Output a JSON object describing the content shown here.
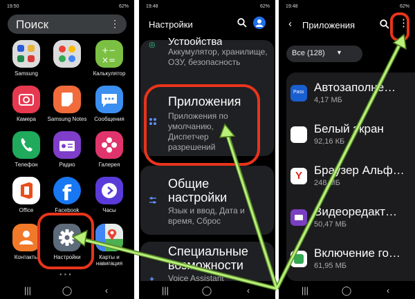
{
  "phone1": {
    "status": {
      "time": "19:50",
      "battery": "62%"
    },
    "search": {
      "label": "Поиск"
    },
    "apps": [
      {
        "label": "Samsung",
        "icon": "samsung-folder-icon"
      },
      {
        "label": "",
        "icon": "google-folder-icon"
      },
      {
        "label": "Калькулятор",
        "icon": "calculator-icon"
      },
      {
        "label": "Камера",
        "icon": "camera-icon"
      },
      {
        "label": "Samsung Notes",
        "icon": "notes-icon"
      },
      {
        "label": "Сообщения",
        "icon": "messages-icon"
      },
      {
        "label": "Телефон",
        "icon": "phone-icon"
      },
      {
        "label": "Радио",
        "icon": "radio-icon"
      },
      {
        "label": "Галерея",
        "icon": "gallery-icon"
      },
      {
        "label": "Office",
        "icon": "office-icon"
      },
      {
        "label": "Facebook",
        "icon": "facebook-icon"
      },
      {
        "label": "Часы",
        "icon": "clock-icon"
      },
      {
        "label": "Контакты",
        "icon": "contacts-icon"
      },
      {
        "label": "Настройки",
        "icon": "settings-gear-icon"
      },
      {
        "label": "Карты и навигация",
        "icon": "maps-icon"
      }
    ]
  },
  "phone2": {
    "status": {
      "time": "19:48",
      "battery": "62%"
    },
    "header": {
      "title": "Настройки"
    },
    "rows": [
      {
        "title": "Устройства",
        "sub": "Аккумулятор, хранилище, ОЗУ, безопасность"
      },
      {
        "title": "Приложения",
        "sub": "Приложения по умолчанию, Диспетчер разрешений"
      },
      {
        "title": "Общие настройки",
        "sub": "Язык и ввод, Дата и время, Сброс"
      },
      {
        "title": "Специальные возможности",
        "sub": "Voice Assistant"
      }
    ]
  },
  "phone3": {
    "status": {
      "time": "19:48",
      "battery": "62%"
    },
    "header": {
      "title": "Приложения"
    },
    "filter": {
      "label": "Все (128)"
    },
    "apps": [
      {
        "name": "Автозаполне…",
        "size": "4,17 МБ",
        "color": "#1a5fd0",
        "icon_text": "Pass"
      },
      {
        "name": "Белый экран",
        "size": "92,16 КБ",
        "color": "#ffffff",
        "icon_text": ""
      },
      {
        "name": "Браузер Альф…",
        "size": "248 МБ",
        "color": "#ffffff",
        "icon_text": "Y"
      },
      {
        "name": "Видеоредакт…",
        "size": "50,47 МБ",
        "color": "#7a3fc0",
        "icon_text": ""
      },
      {
        "name": "Включение го…",
        "size": "61,95 МБ",
        "color": "#ffffff",
        "icon_text": ""
      }
    ]
  },
  "colors": {
    "highlight": "#e8341c",
    "arrow": "#b8f07a",
    "accent": "#1f6fe8"
  }
}
